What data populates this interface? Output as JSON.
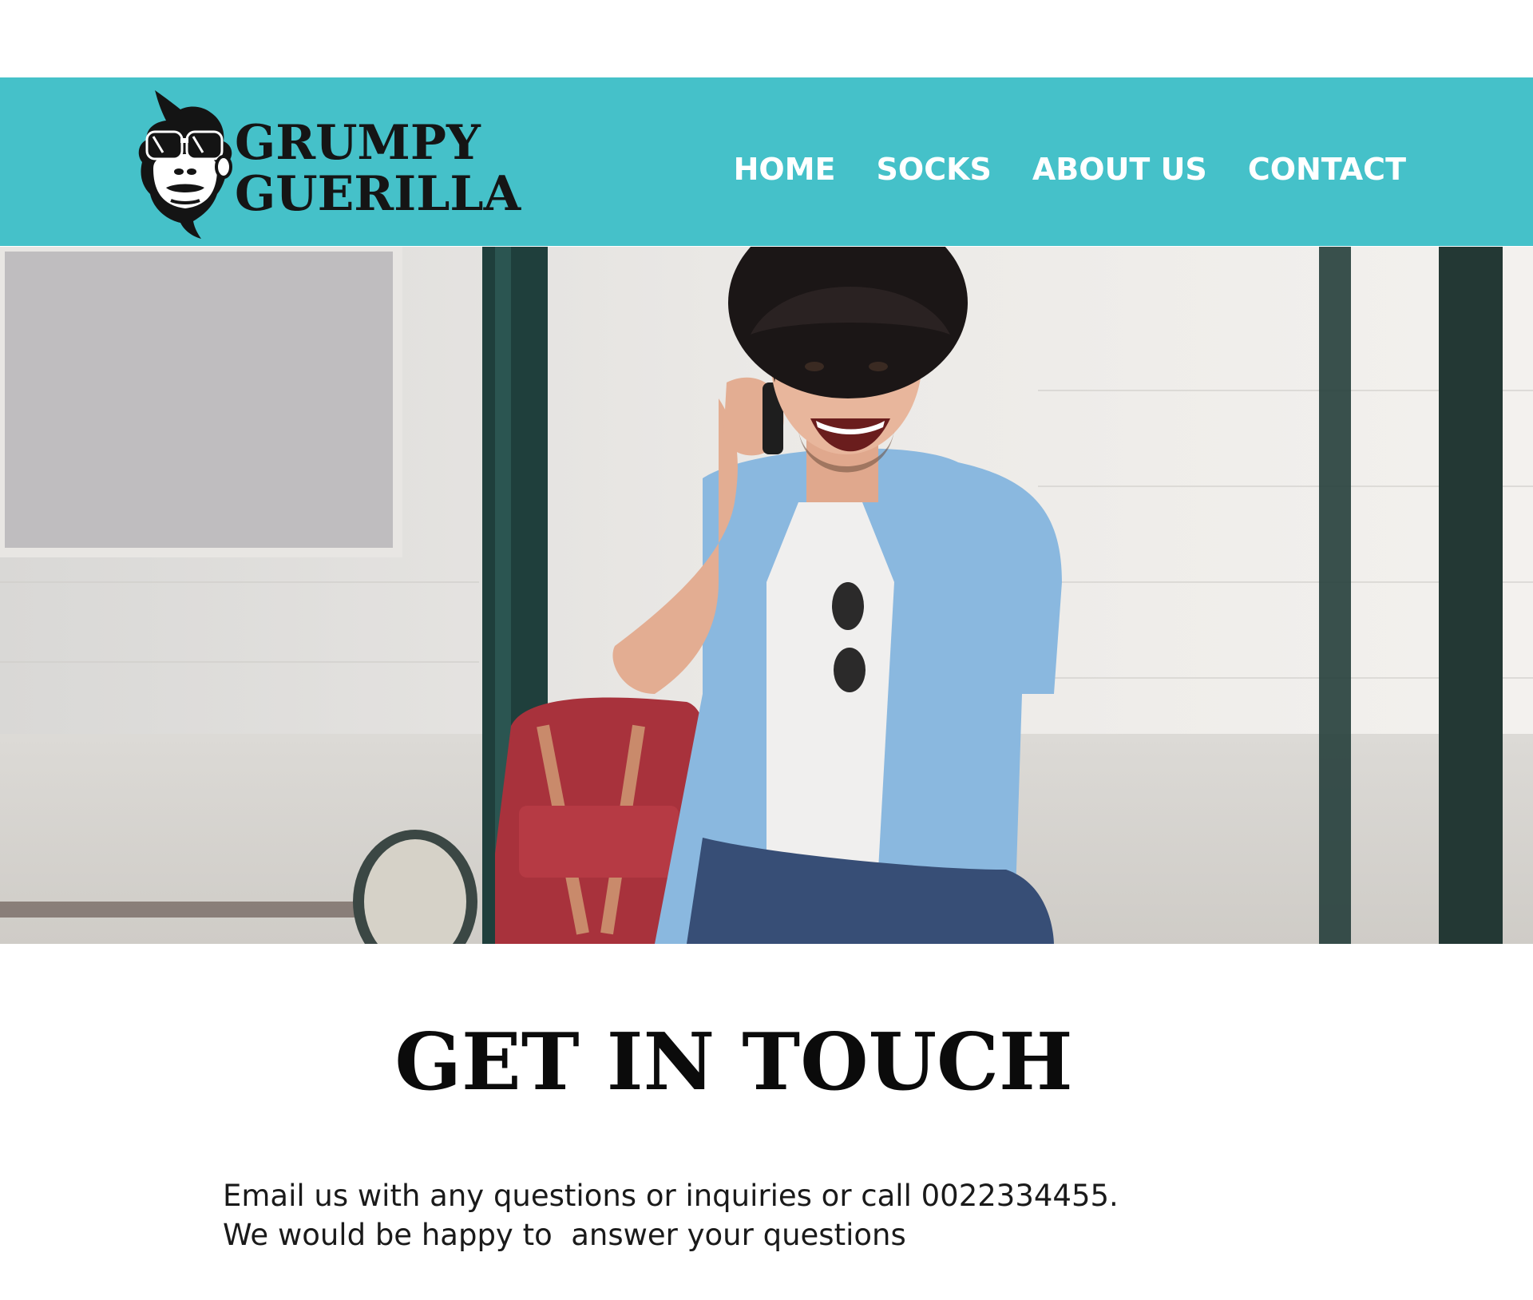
{
  "brand": {
    "line1": "GRUMPY",
    "line2": "GUERILLA",
    "logo_icon": "gorilla-sunglasses-icon"
  },
  "nav": {
    "items": [
      {
        "label": "HOME"
      },
      {
        "label": "SOCKS"
      },
      {
        "label": "ABOUT US"
      },
      {
        "label": "CONTACT"
      }
    ]
  },
  "hero": {
    "image": "man-with-hat-on-phone-at-bus-stop"
  },
  "contact": {
    "heading": "GET IN TOUCH",
    "line1": "Email us with any questions or inquiries or call 0022334455.",
    "line2": "We would be happy to  answer your questions"
  },
  "colors": {
    "header_bg": "#45c1c9",
    "nav_text": "#ffffff",
    "page_bg": "#ffffff",
    "text": "#1a1a1a"
  }
}
